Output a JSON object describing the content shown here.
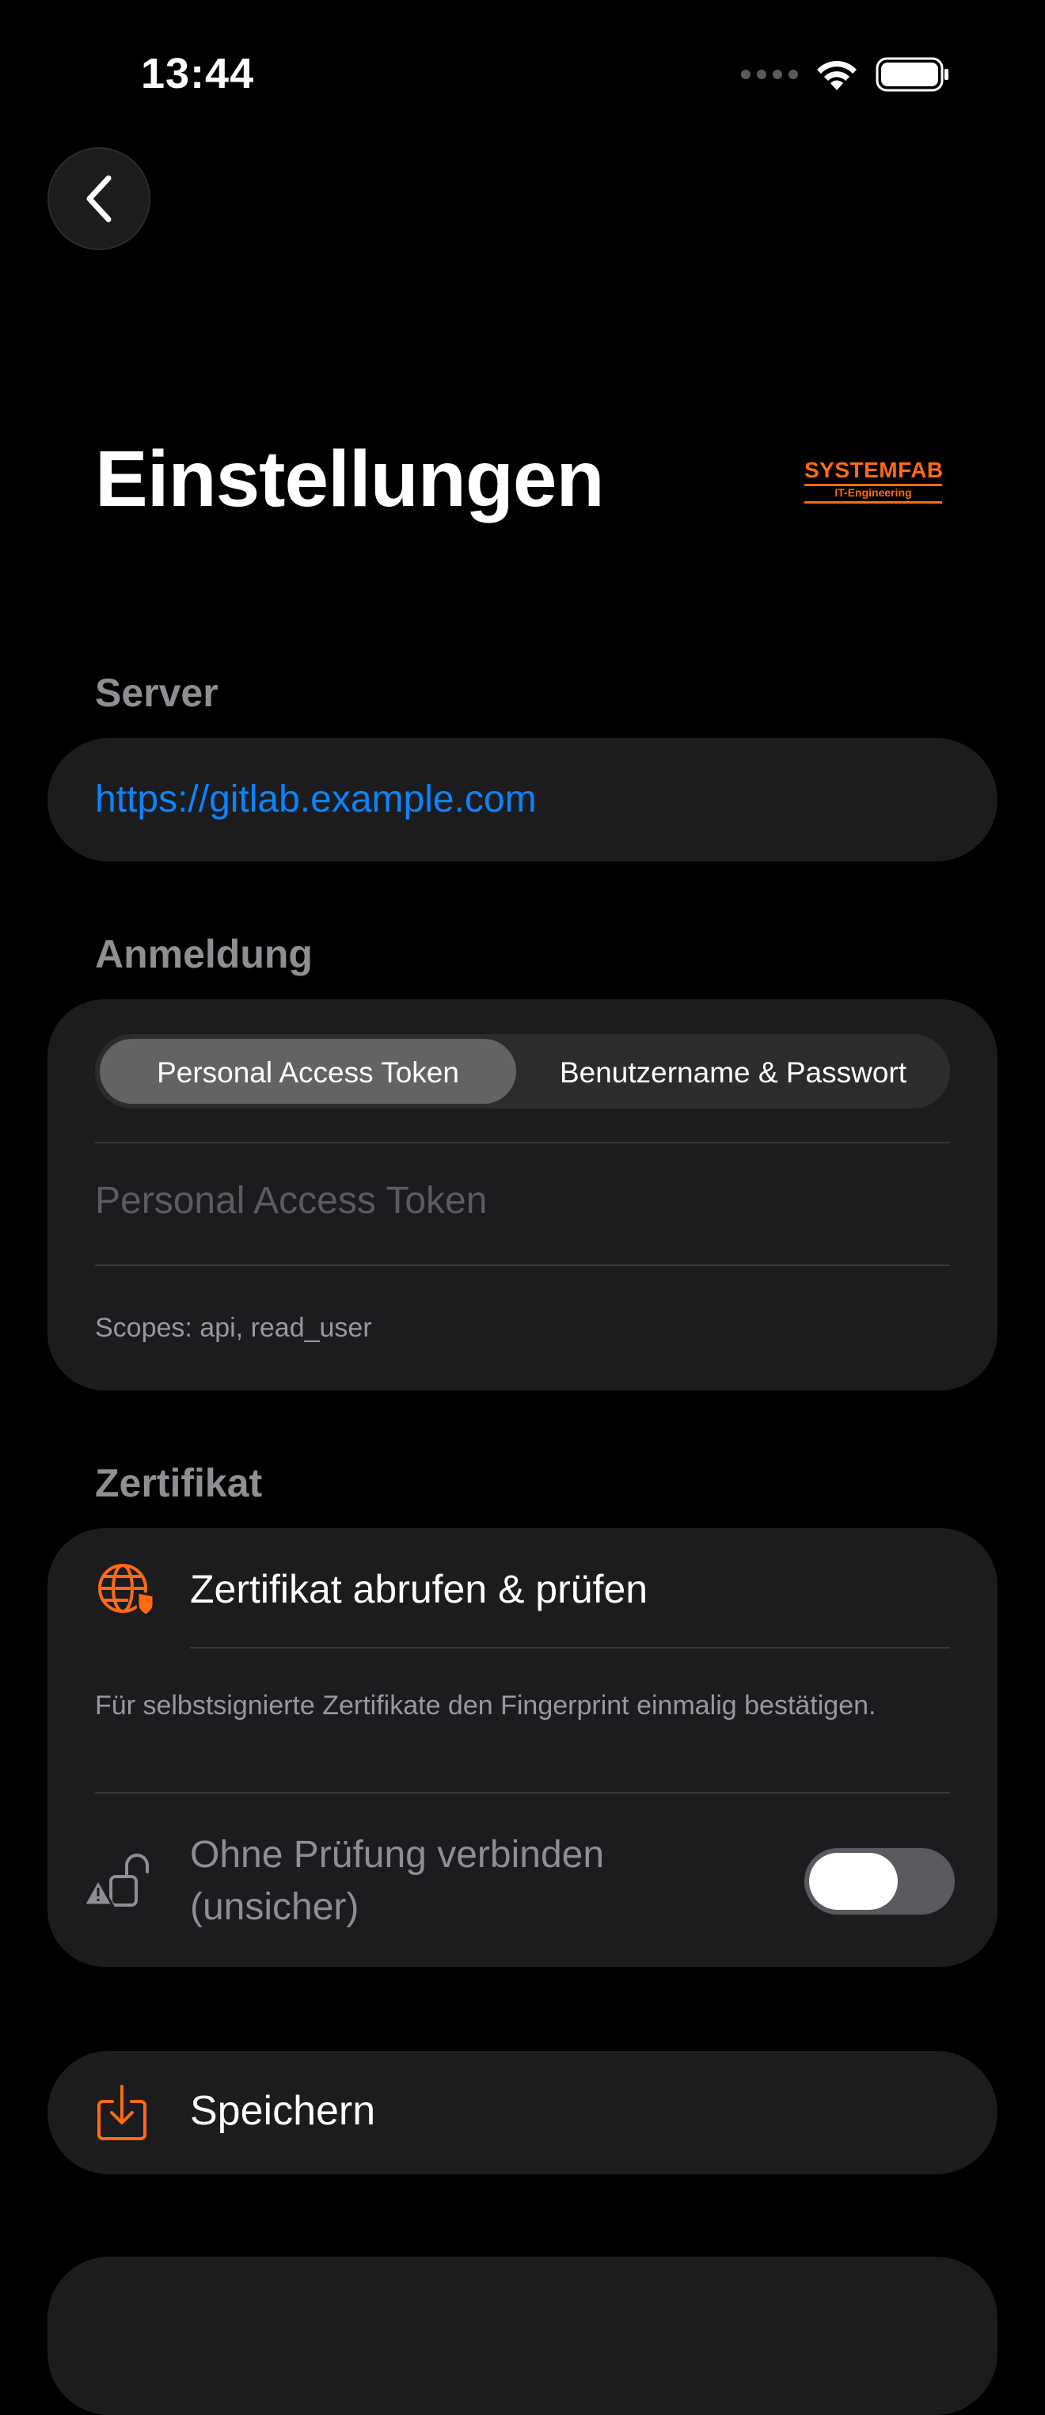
{
  "status_bar": {
    "time": "13:44",
    "icons": [
      "signal-dots",
      "wifi-icon",
      "battery-icon"
    ]
  },
  "navigation": {
    "back_icon": "chevron-left-icon"
  },
  "header": {
    "title": "Einstellungen",
    "logo": {
      "line1": "SYSTEMFAB",
      "line2": "IT-Engineering",
      "color": "#ff6a13"
    }
  },
  "server": {
    "label": "Server",
    "url": "https://gitlab.example.com"
  },
  "login": {
    "label": "Anmeldung",
    "segments": [
      "Personal Access Token",
      "Benutzername & Passwort"
    ],
    "selected_segment": "Personal Access Token",
    "token_placeholder": "Personal Access Token",
    "token_value": "",
    "scopes_hint": "Scopes: api, read_user"
  },
  "certificate": {
    "label": "Zertifikat",
    "fetch_action": "Zertifikat abrufen & prüfen",
    "fetch_icon": "globe-shield-icon",
    "note": "Für selbstsignierte Zertifikate den Fingerprint einmalig bestätigen.",
    "insecure_line1": "Ohne Prüfung verbinden",
    "insecure_line2": "(unsicher)",
    "insecure_icon": "unlock-warning-icon",
    "insecure_enabled": false
  },
  "actions": {
    "save_label": "Speichern",
    "save_icon": "download-tray-icon"
  },
  "colors": {
    "background": "#000000",
    "card": "#1c1c1e",
    "accent_link": "#0a84ff",
    "accent_orange": "#ff6a13",
    "secondary_text": "#8e8e93"
  }
}
